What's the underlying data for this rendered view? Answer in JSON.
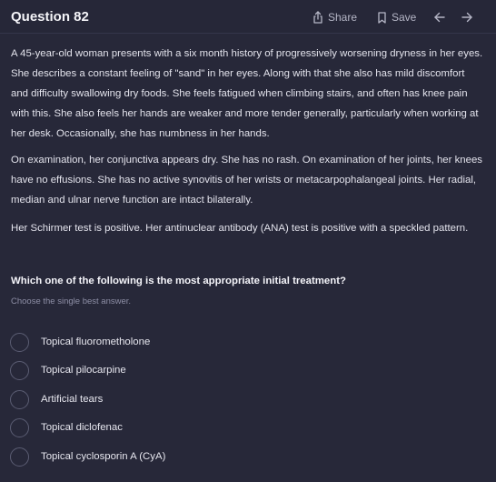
{
  "header": {
    "title": "Question 82",
    "share_label": "Share",
    "save_label": "Save"
  },
  "stem": {
    "p1": "A 45-year-old woman presents with a six month history of progressively worsening dryness in her eyes. She describes a constant feeling of \"sand\" in her eyes. Along with that she also has mild discomfort and difficulty swallowing dry foods. She feels fatigued when climbing stairs, and often has knee pain with this. She also feels her hands are weaker and more tender generally, particularly when working at her desk. Occasionally, she has numbness in her hands.",
    "p2": "On examination, her conjunctiva appears dry. She has no rash. On examination of her joints, her knees have no effusions. She has no active synovitis of her wrists or metacarpophalangeal joints. Her radial, median and ulnar nerve function are intact bilaterally.",
    "p3": "Her Schirmer test is positive. Her antinuclear antibody (ANA) test is positive with a speckled pattern."
  },
  "question": "Which one of the following is the most appropriate initial treatment?",
  "hint": "Choose the single best answer.",
  "options": [
    "Topical fluorometholone",
    "Topical pilocarpine",
    "Artificial tears",
    "Topical diclofenac",
    "Topical cyclosporin A (CyA)"
  ],
  "colors": {
    "background": "#272839",
    "text": "#e3e3ec",
    "muted": "#8e8fa6",
    "radio_border": "#5b5d73"
  },
  "icons": {
    "share": "share-icon",
    "save": "bookmark-icon",
    "prev": "arrow-left-icon",
    "next": "arrow-right-icon"
  }
}
